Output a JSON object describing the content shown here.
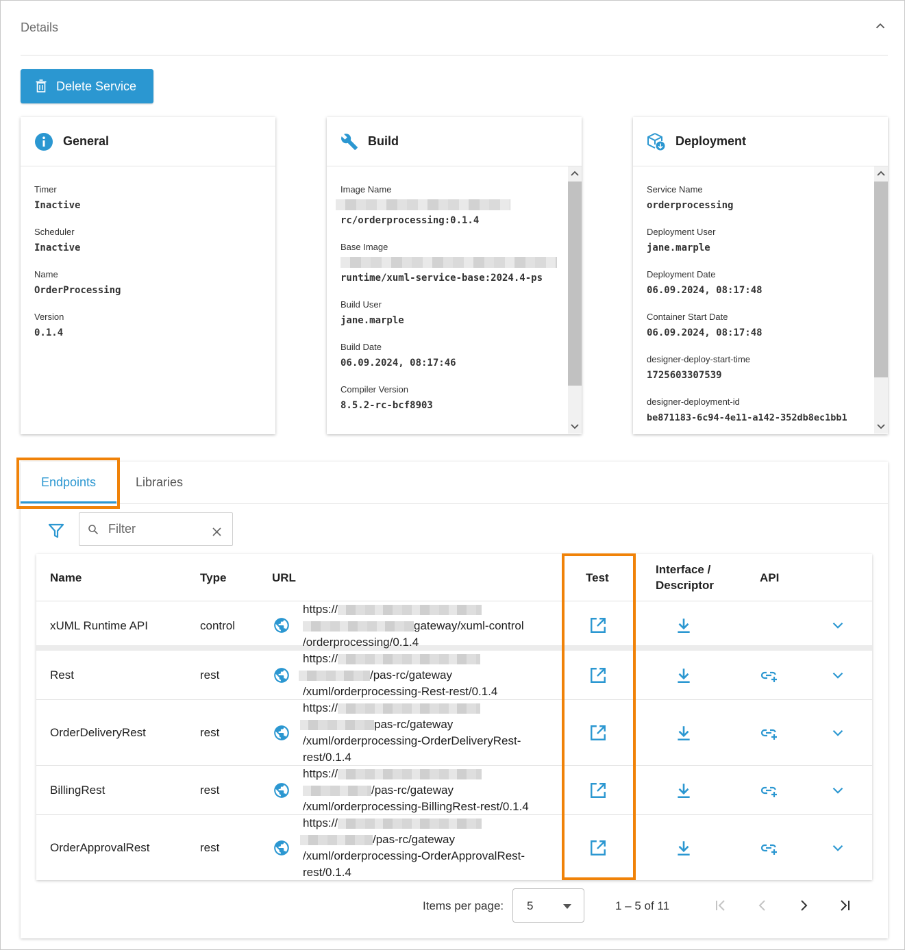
{
  "details": {
    "title": "Details"
  },
  "actions": {
    "delete_label": "Delete Service"
  },
  "general": {
    "title": "General",
    "fields": [
      {
        "label": "Timer",
        "value": "Inactive"
      },
      {
        "label": "Scheduler",
        "value": "Inactive"
      },
      {
        "label": "Name",
        "value": "OrderProcessing"
      },
      {
        "label": "Version",
        "value": "0.1.4"
      }
    ]
  },
  "build": {
    "title": "Build",
    "fields": [
      {
        "label": "Image Name",
        "value": "rc/orderprocessing:0.1.4"
      },
      {
        "label": "Base Image",
        "value": "runtime/xuml-service-base:2024.4-ps"
      },
      {
        "label": "Build User",
        "value": "jane.marple"
      },
      {
        "label": "Build Date",
        "value": "06.09.2024, 08:17:46"
      },
      {
        "label": "Compiler Version",
        "value": "8.5.2-rc-bcf8903"
      }
    ]
  },
  "deployment": {
    "title": "Deployment",
    "fields": [
      {
        "label": "Service Name",
        "value": "orderprocessing"
      },
      {
        "label": "Deployment User",
        "value": "jane.marple"
      },
      {
        "label": "Deployment Date",
        "value": "06.09.2024, 08:17:48"
      },
      {
        "label": "Container Start Date",
        "value": "06.09.2024, 08:17:48"
      },
      {
        "label": "designer-deploy-start-time",
        "value": "1725603307539"
      },
      {
        "label": "designer-deployment-id",
        "value": "be871183-6c94-4e11-a142-352db8ec1bb1"
      }
    ]
  },
  "tabs": {
    "endpoints": "Endpoints",
    "libraries": "Libraries"
  },
  "filter": {
    "placeholder": "Filter"
  },
  "table": {
    "headers": {
      "name": "Name",
      "type": "Type",
      "url": "URL",
      "test": "Test",
      "interface_line1": "Interface /",
      "interface_line2": "Descriptor",
      "api": "API"
    },
    "rows": [
      {
        "name": "xUML Runtime API",
        "type": "control",
        "url_lines": [
          "https://",
          "gateway/xuml-control",
          "/orderprocessing/0.1.4"
        ]
      },
      {
        "name": "Rest",
        "type": "rest",
        "url_lines": [
          "https://",
          "/pas-rc/gateway",
          "/xuml/orderprocessing-Rest-rest/0.1.4"
        ]
      },
      {
        "name": "OrderDeliveryRest",
        "type": "rest",
        "url_lines": [
          "https://",
          "pas-rc/gateway",
          "/xuml/orderprocessing-OrderDeliveryRest-",
          "rest/0.1.4"
        ]
      },
      {
        "name": "BillingRest",
        "type": "rest",
        "url_lines": [
          "https://",
          "/pas-rc/gateway",
          "/xuml/orderprocessing-BillingRest-rest/0.1.4"
        ]
      },
      {
        "name": "OrderApprovalRest",
        "type": "rest",
        "url_lines": [
          "https://",
          "/pas-rc/gateway",
          "/xuml/orderprocessing-OrderApprovalRest-",
          "rest/0.1.4"
        ]
      }
    ]
  },
  "paginator": {
    "items_per_page_label": "Items per page:",
    "items_per_page_value": "5",
    "range_label": "1 – 5 of 11"
  },
  "colors": {
    "accent": "#2b97d1",
    "highlight": "#f08208"
  }
}
